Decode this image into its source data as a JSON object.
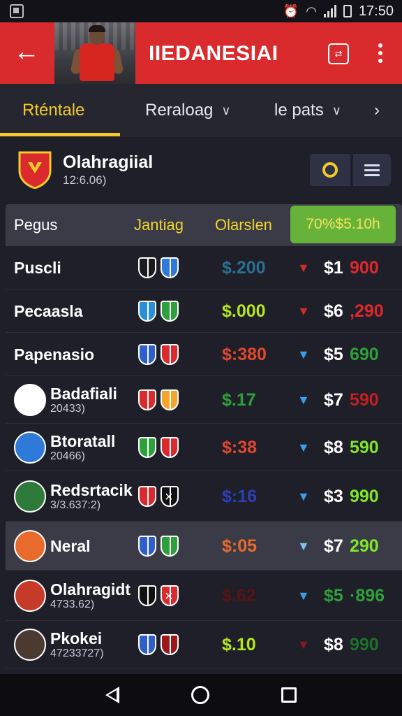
{
  "status": {
    "time": "17:50"
  },
  "app": {
    "title": "IIEDANESIAI",
    "back_icon": "arrow-left-icon",
    "cast_icon": "cast-icon",
    "more_icon": "more-vert-icon"
  },
  "tabs": [
    {
      "label": "Rténtale",
      "active": true
    },
    {
      "label": "Reraloag",
      "active": false
    },
    {
      "label": "le pats",
      "active": false
    }
  ],
  "league": {
    "name": "Olahragiial",
    "sub": "12:6.06)"
  },
  "table": {
    "headers": [
      "Pegus",
      "Jantiag",
      "Olarslen",
      "70%$5.10h"
    ],
    "rows": [
      {
        "name": "Puscli",
        "sub": "",
        "odds": "$.200",
        "odds_color": "#2a6f8f",
        "arrow_color": "#d12a2a",
        "arrow": "down-red",
        "price_a": "$1",
        "price_b": "900",
        "price_color": "#e0282c"
      },
      {
        "name": "Pecaasla",
        "sub": "",
        "odds": "$.000",
        "odds_color": "#b5e61d",
        "arrow_color": "#d12a2a",
        "arrow": "down-red",
        "price_a": "$6",
        "price_b": ",290",
        "price_color": "#e0282c"
      },
      {
        "name": "Papenasio",
        "sub": "",
        "odds": "$:380",
        "odds_color": "#e0482c",
        "arrow_color": "#3b9ee8",
        "arrow": "down-blue",
        "price_a": "$5",
        "price_b": "690",
        "price_color": "#2ea03a"
      },
      {
        "name": "Badafiali",
        "sub": "20433)",
        "odds": "$.17",
        "odds_color": "#2ea03a",
        "arrow_color": "#3b9ee8",
        "arrow": "down-blue",
        "price_a": "$7",
        "price_b": "590",
        "price_color": "#c41e22"
      },
      {
        "name": "Btoratall",
        "sub": "20466)",
        "odds": "$:38",
        "odds_color": "#e0482c",
        "arrow_color": "#3b9ee8",
        "arrow": "down-blue",
        "price_a": "$8",
        "price_b": "590",
        "price_color": "#7fe62b"
      },
      {
        "name": "Redsrtacik",
        "sub": "3/3.637:2)",
        "odds": "$:16",
        "odds_color": "#2d3fb5",
        "arrow_color": "#3b9ee8",
        "arrow": "down-blue",
        "price_a": "$3",
        "price_b": "990",
        "price_color": "#7fe62b",
        "x": "×"
      },
      {
        "name": "Neral",
        "sub": "",
        "odds": "$:05",
        "odds_color": "#e86a2c",
        "arrow_color": "#7ec4f0",
        "arrow": "down-lightblue",
        "price_a": "$7",
        "price_b": "290",
        "price_color": "#7fe62b",
        "highlight": true
      },
      {
        "name": "Olahragidt",
        "sub": "4733.62)",
        "odds": "$.62",
        "odds_color": "#5a1214",
        "arrow_color": "#3b9ee8",
        "arrow": "down-blue",
        "price_a": "$5",
        "price_b": "·896",
        "price_color": "#2ea03a",
        "price_a_color": "#2ea03a",
        "x": "×"
      },
      {
        "name": "Pkokei",
        "sub": "47233727)",
        "odds": "$.10",
        "odds_color": "#b5e61d",
        "arrow_color": "#8a1a1c",
        "arrow": "down-red",
        "price_a": "$8",
        "price_b": "990",
        "price_color": "#1f6f2a"
      }
    ]
  },
  "colors": {
    "accent": "#d92b2e",
    "highlight": "#f3c92c",
    "header_green": "#67b33a"
  }
}
